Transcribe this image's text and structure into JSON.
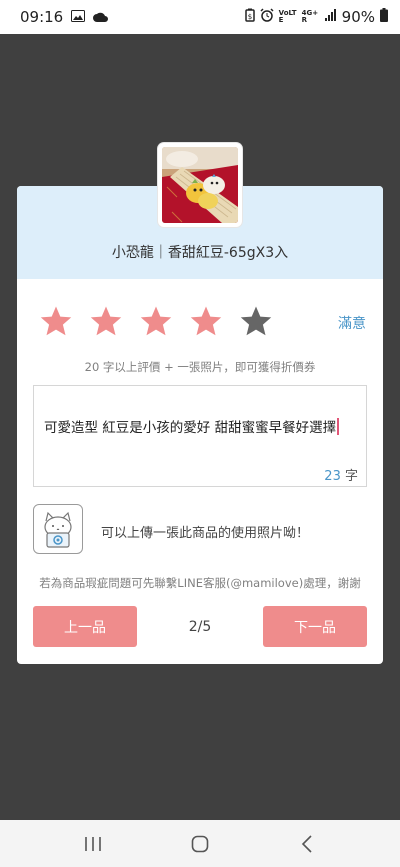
{
  "status_bar": {
    "time": "09:16",
    "net_small_1": "VoLTE",
    "net_small_2": "4G+ R",
    "battery": "90%"
  },
  "product": {
    "name": "小恐龍｜香甜紅豆-65gX3入"
  },
  "rating": {
    "value": 4,
    "max": 5,
    "label": "滿意",
    "filled_color": "#ef8c8c",
    "empty_color": "#666666"
  },
  "hint": "20 字以上評價 + 一張照片，即可獲得折價券",
  "review": {
    "text": "可愛造型 紅豆是小孩的愛好 甜甜蜜蜜早餐好選擇",
    "char_count": "23",
    "char_unit": "字"
  },
  "upload": {
    "label": "可以上傳一張此商品的使用照片呦！"
  },
  "note": "若為商品瑕疵問題可先聯繫LINE客服(@mamilove)處理，謝謝",
  "pagination": {
    "prev_label": "上一品",
    "next_label": "下一品",
    "indicator": "2/5"
  },
  "colors": {
    "accent_pink": "#ef8c8c",
    "accent_blue": "#4a95c8",
    "header_bg": "#ddeefa",
    "overlay": "#404040"
  }
}
